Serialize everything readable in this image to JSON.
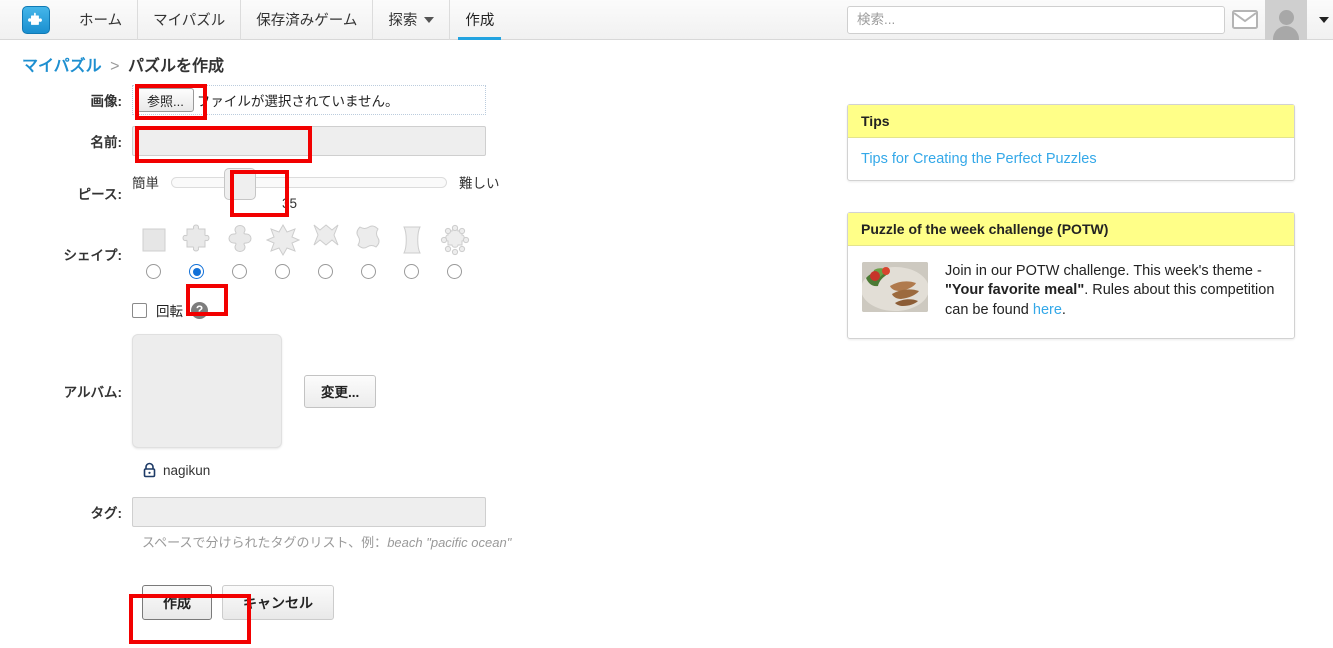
{
  "header": {
    "logo_icon": "puzzle-piece-logo",
    "nav": [
      {
        "label": "ホーム",
        "active": false,
        "dropdown": false
      },
      {
        "label": "マイパズル",
        "active": false,
        "dropdown": false
      },
      {
        "label": "保存済みゲーム",
        "active": false,
        "dropdown": false
      },
      {
        "label": "探索",
        "active": false,
        "dropdown": true
      },
      {
        "label": "作成",
        "active": true,
        "dropdown": false
      }
    ],
    "search": {
      "value": "",
      "placeholder": "検索..."
    },
    "mail_icon": "envelope-icon",
    "avatar_icon": "user-avatar-icon",
    "user_caret_icon": "chevron-down-icon"
  },
  "breadcrumb": {
    "parent": "マイパズル",
    "separator": ">",
    "current": "パズルを作成"
  },
  "form": {
    "image": {
      "label": "画像:",
      "browse_button": "参照...",
      "status": "ファイルが選択されていません。"
    },
    "name": {
      "label": "名前:",
      "value": "",
      "placeholder": ""
    },
    "pieces": {
      "label": "ピース:",
      "easy_label": "簡単",
      "hard_label": "難しい",
      "value": "35",
      "min": 0,
      "max": 100
    },
    "shape": {
      "label": "シェイプ:",
      "selected_index": 1,
      "options": [
        {
          "name": "square-shape"
        },
        {
          "name": "classic-jigsaw-shape"
        },
        {
          "name": "cross-knob-shape"
        },
        {
          "name": "star-six-point-shape"
        },
        {
          "name": "star-pointed-shape"
        },
        {
          "name": "curvy-leather-shape"
        },
        {
          "name": "barrel-shape"
        },
        {
          "name": "many-knob-shape"
        }
      ]
    },
    "rotation": {
      "label": "回転",
      "checked": false,
      "help_icon": "question-mark-icon"
    },
    "album": {
      "label": "アルバム:",
      "change_button": "変更...",
      "owner": "nagikun",
      "lock_icon": "padlock-icon"
    },
    "tags": {
      "label": "タグ:",
      "value": "",
      "hint_prefix": "スペースで分けられたタグのリスト、例：",
      "hint_example": "beach \"pacific ocean\""
    },
    "buttons": {
      "create": "作成",
      "cancel": "キャンセル"
    }
  },
  "sidebar": {
    "tips": {
      "title": "Tips",
      "link": "Tips for Creating the Perfect Puzzles"
    },
    "potw": {
      "title": "Puzzle of the week challenge (POTW)",
      "thumb_icon": "food-photo-thumbnail",
      "text_before": "Join in our POTW challenge. This week's theme - ",
      "theme": "\"Your favorite meal\"",
      "text_middle": ". Rules about this competition can be found ",
      "link": "here",
      "text_after": "."
    }
  },
  "annotations": {
    "color": "#f20000",
    "boxes": [
      {
        "name": "browse-button-highlight"
      },
      {
        "name": "name-input-highlight"
      },
      {
        "name": "slider-thumb-highlight"
      },
      {
        "name": "shape-radio-highlight"
      },
      {
        "name": "create-button-highlight"
      }
    ]
  }
}
